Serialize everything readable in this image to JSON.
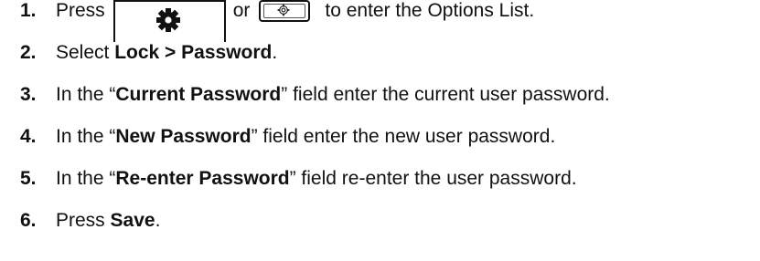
{
  "steps": [
    {
      "number": "1.",
      "text_before": "Press",
      "text_middle": "or",
      "text_after": "to enter the Options List.",
      "icons": [
        "gear-key-icon",
        "gear-button-icon"
      ]
    },
    {
      "number": "2.",
      "text_before": "Select ",
      "bold": "Lock > Password",
      "text_after": "."
    },
    {
      "number": "3.",
      "text_before": "In the “",
      "bold": "Current Password",
      "text_after": "” field enter the current user password."
    },
    {
      "number": "4.",
      "text_before": "In the “",
      "bold": "New Password",
      "text_after": "” field enter the new user password."
    },
    {
      "number": "5.",
      "text_before": "In the “",
      "bold": "Re-enter Password",
      "text_after": "” field re-enter the user password."
    },
    {
      "number": "6.",
      "text_before": "Press ",
      "bold": "Save",
      "text_after": "."
    }
  ]
}
